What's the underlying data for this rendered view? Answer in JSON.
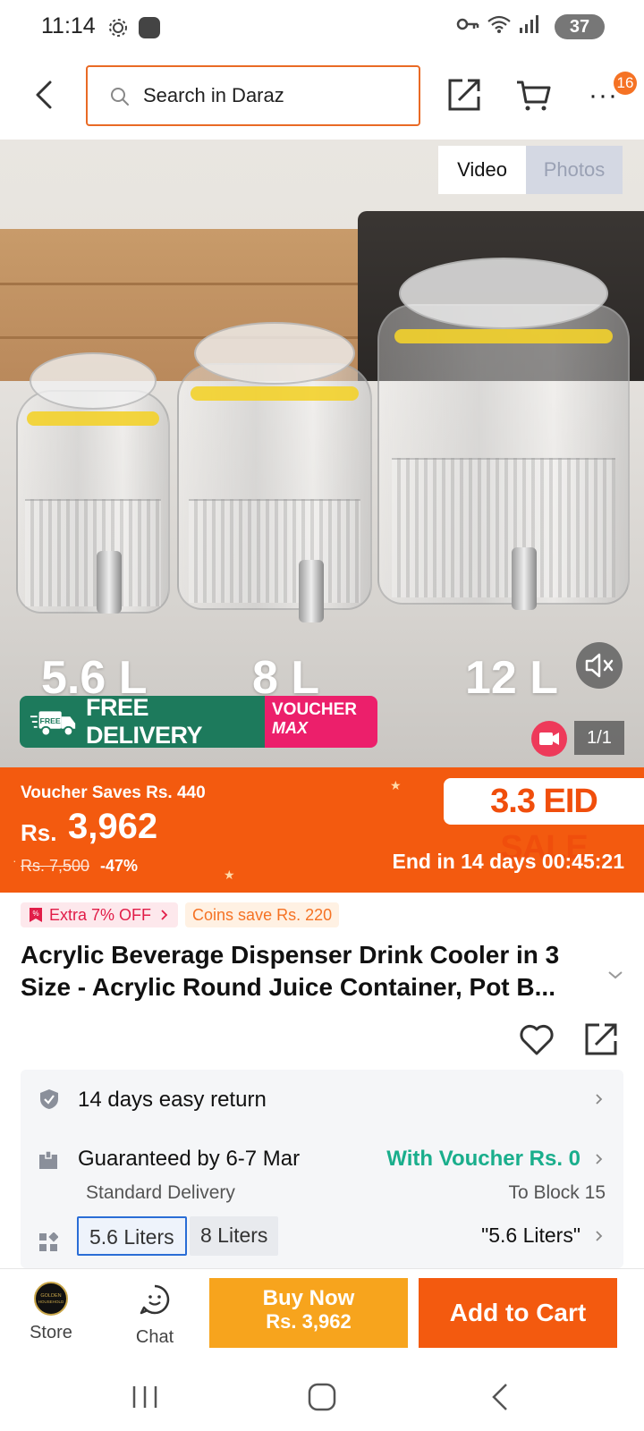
{
  "status_bar": {
    "time": "11:14",
    "battery": "37",
    "icons": [
      "settings-icon",
      "record-icon",
      "key-icon",
      "wifi-icon",
      "signal-icon",
      "battery-icon"
    ]
  },
  "header": {
    "search_placeholder": "Search in Daraz",
    "cart_badge": "16",
    "icons": [
      "back-icon",
      "search-icon",
      "share-icon",
      "cart-icon",
      "more-icon"
    ]
  },
  "media": {
    "tab_video": "Video",
    "tab_photos": "Photos",
    "active_tab": "Video",
    "size_labels": [
      "5.6 L",
      "8 L",
      "12 L"
    ],
    "delivery_text": "FREE DELIVERY",
    "delivery_badge": "FREE",
    "voucher_line1": "VOUCHER",
    "voucher_line2": "MAX",
    "page_counter": "1/1"
  },
  "price": {
    "voucher_saves": "Voucher Saves Rs. 440",
    "currency": "Rs.",
    "amount": "3,962",
    "original": "Rs. 7,500",
    "discount": "-47%",
    "sale_tag": "3.3 EID SALE",
    "sale_end": "End in 14 days 00:45:21"
  },
  "promos": {
    "extra_off": "Extra 7% OFF",
    "coins_save": "Coins save Rs. 220"
  },
  "product": {
    "title": "Acrylic Beverage Dispenser Drink Cooler in 3 Size - Acrylic Round Juice Container, Pot B..."
  },
  "info": {
    "return_label": "14 days easy return",
    "delivery_label": "Guaranteed by 6-7 Mar",
    "delivery_sub": "Standard Delivery",
    "voucher_price": "With Voucher Rs. 0",
    "delivery_to": "To Block 15",
    "variants": [
      "5.6 Liters",
      "8 Liters"
    ],
    "selected_variant": "\"5.6 Liters\""
  },
  "bottom_bar": {
    "store_label": "Store",
    "store_logo_text": "GOLDEN HOUSEHOLD",
    "chat_label": "Chat",
    "buy_now_line1": "Buy Now",
    "buy_now_line2": "Rs. 3,962",
    "add_to_cart": "Add to Cart"
  },
  "colors": {
    "brand_orange": "#f35a0f",
    "buy_now": "#f7a41d",
    "voucher_green": "#1aae8c",
    "delivery_green": "#1d7a5c",
    "voucher_pink": "#ec1f6b"
  }
}
